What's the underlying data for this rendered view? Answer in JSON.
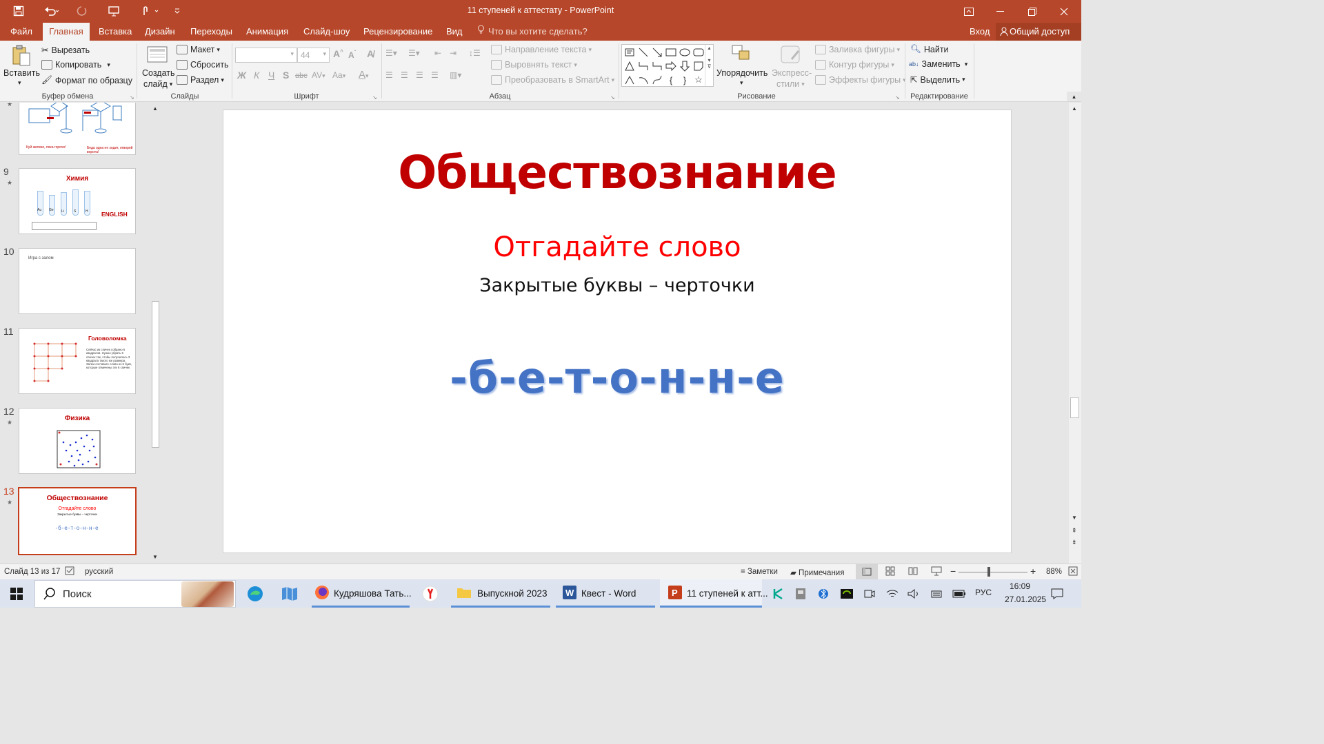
{
  "window": {
    "title": "11 ступеней к аттестату - PowerPoint"
  },
  "tabs": [
    "Файл",
    "Главная",
    "Вставка",
    "Дизайн",
    "Переходы",
    "Анимация",
    "Слайд-шоу",
    "Рецензирование",
    "Вид"
  ],
  "tell_me": "Что вы хотите сделать?",
  "signin": "Вход",
  "share": "Общий доступ",
  "ribbon": {
    "clipboard": {
      "paste": "Вставить",
      "cut": "Вырезать",
      "copy": "Копировать",
      "format_painter": "Формат по образцу",
      "label": "Буфер обмена"
    },
    "slides": {
      "new_slide_1": "Создать",
      "new_slide_2": "слайд",
      "layout": "Макет",
      "reset": "Сбросить",
      "section": "Раздел",
      "label": "Слайды"
    },
    "font": {
      "size": "44",
      "bold": "Ж",
      "italic": "К",
      "underline": "Ч",
      "shadow": "S",
      "strike": "abc",
      "spacing": "AV",
      "case": "Aa",
      "label": "Шрифт"
    },
    "paragraph": {
      "text_direction": "Направление текста",
      "align_text": "Выровнять текст",
      "smartart": "Преобразовать в SmartArt",
      "label": "Абзац"
    },
    "drawing": {
      "arrange": "Упорядочить",
      "quick_styles_1": "Экспресс-",
      "quick_styles_2": "стили",
      "shape_fill": "Заливка фигуры",
      "shape_outline": "Контур фигуры",
      "shape_effects": "Эффекты фигуры",
      "label": "Рисование"
    },
    "editing": {
      "find": "Найти",
      "replace": "Заменить",
      "select": "Выделить",
      "label": "Редактирование"
    }
  },
  "thumbnails": [
    {
      "num": "",
      "caption_a": "Куй железо, пока горячо!",
      "caption_b": "Беда одна не ходит, отворяй ворота!"
    },
    {
      "num": "9",
      "title": "Химия",
      "side": "ENGLISH",
      "tubes": [
        "Au",
        "Ge",
        "Li",
        "S",
        "H"
      ]
    },
    {
      "num": "10",
      "text": "Игра с залом"
    },
    {
      "num": "11",
      "title": "Головоломка",
      "body": "Сейчас из спичек собрано 6 квадратов. Нужно убрать 6 спичек так, чтобы получилось 3 квадрата такого же размера. Затем составьте слово из 6 букв, которые отмечены эти 6 спичек"
    },
    {
      "num": "12",
      "title": "Физика"
    },
    {
      "num": "13",
      "title": "Обществознание",
      "sub": "Отгадайте слово",
      "desc": "Закрытые буквы – черточки",
      "word": "-б-е-т-о-н-н-е"
    }
  ],
  "slide": {
    "title": "Обществознание",
    "subtitle": "Отгадайте слово",
    "description": "Закрытые буквы – черточки",
    "word": "-б-е-т-о-н-н-е"
  },
  "status": {
    "slide_of": "Слайд 13 из 17",
    "language": "русский",
    "notes": "Заметки",
    "comments": "Примечания",
    "zoom": "88%"
  },
  "taskbar": {
    "search": "Поиск",
    "apps": [
      {
        "label": "Кудряшова Тать..."
      },
      {
        "label": "Выпускной 2023"
      },
      {
        "label": "Квест - Word"
      },
      {
        "label": "11 ступеней к атт..."
      }
    ],
    "lang": "РУС",
    "time": "16:09",
    "date": "27.01.2025"
  },
  "colors": {
    "accent": "#b7472a",
    "title_red": "#c00000",
    "subtitle_red": "#ff0000",
    "word_blue": "#4472c4"
  }
}
